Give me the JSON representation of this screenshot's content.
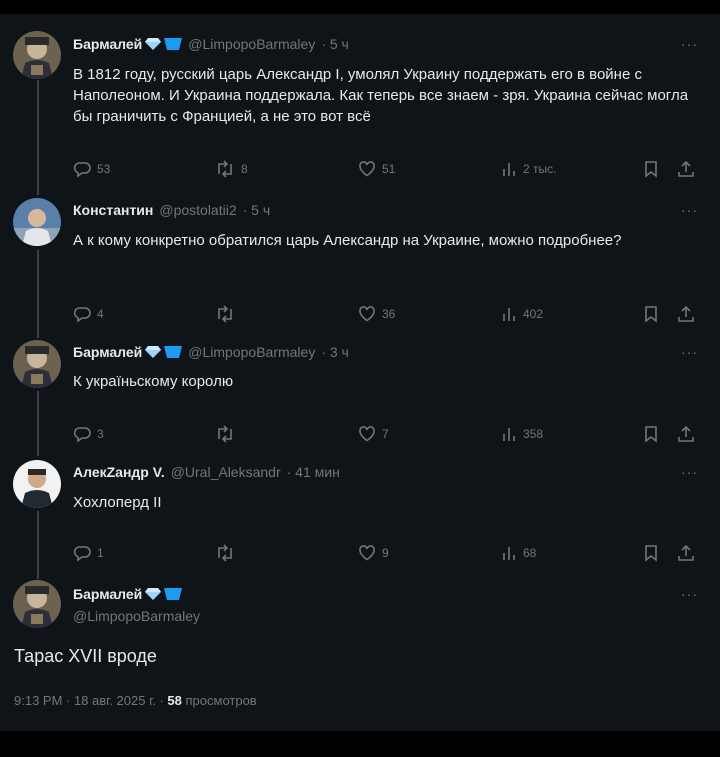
{
  "tweets": [
    {
      "name": "Бармалей",
      "handle": "@LimpopoBarmaley",
      "time": "· 5 ч",
      "more": "···",
      "text": "В 1812 году, русский царь Александр I, умолял Украину поддержать его в войне с Наполеоном. И Украина поддержала. Как теперь все знаем - зря. Украина сейчас могла бы граничить с Францией, а не это вот всё",
      "replies": "53",
      "retweets": "8",
      "likes": "51",
      "views": "2 тыс."
    },
    {
      "name": "Константин",
      "handle": "@postolatii2",
      "time": "· 5 ч",
      "more": "···",
      "text": "А к кому конкретно обратился царь Александр на Украине, можно подробнее?",
      "replies": "4",
      "retweets": "",
      "likes": "36",
      "views": "402"
    },
    {
      "name": "Бармалей",
      "handle": "@LimpopoBarmaley",
      "time": "· 3 ч",
      "more": "···",
      "text": "К украïньскому королю",
      "replies": "3",
      "retweets": "",
      "likes": "7",
      "views": "358"
    },
    {
      "name": "АлекZандр V.",
      "handle": "@Ural_Aleksandr",
      "time": "· 41 мин",
      "more": "···",
      "text": "Хохлоперд II",
      "replies": "1",
      "retweets": "",
      "likes": "9",
      "views": "68"
    }
  ],
  "main": {
    "name": "Бармалей",
    "handle": "@LimpopoBarmaley",
    "more": "···",
    "text": "Тарас XVII вроде",
    "timestamp": "9:13 PM · 18 авг. 2025 г. ·",
    "views_count": "58",
    "views_label": "просмотров"
  },
  "icons": {
    "reply": "reply-icon",
    "retweet": "retweet-icon",
    "like": "like-icon",
    "views": "views-icon",
    "bookmark": "bookmark-icon",
    "share": "share-icon",
    "diamond": "diamond-icon",
    "verified": "verified-badge-icon"
  },
  "colors": {
    "background": "#0f1419",
    "text": "#e7e9ea",
    "secondary": "#71767b",
    "badge": "#1d9bf0"
  }
}
